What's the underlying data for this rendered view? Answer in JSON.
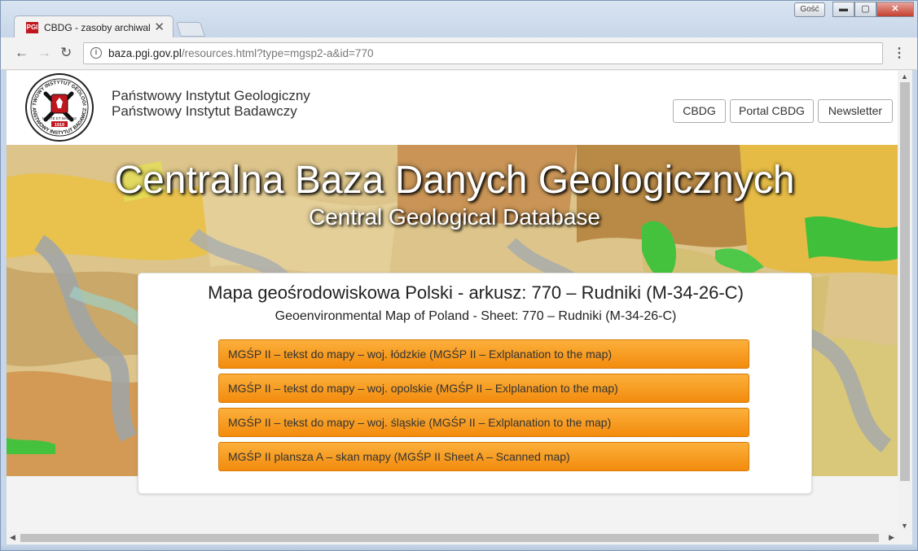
{
  "browser": {
    "tab_title": "CBDG - zasoby archiwaln",
    "favicon_text": "PGI",
    "tab_close": "✕",
    "guest_label": "Gość",
    "url_host": "baza.pgi.gov.pl",
    "url_path": "/resources.html?type=mgsp2-a&id=770",
    "window_min": "▬",
    "window_max": "▢",
    "window_close": "✕"
  },
  "header": {
    "logo_text_top": "PAŃSTWOWY INSTYTUT GEOLOGICZNY",
    "logo_text_bottom": "PAŃSTWOWY INSTYTUT BADAWCZY",
    "logo_motto": "MENTE ET MALLEO",
    "logo_year": "1919",
    "institute_line1": "Państwowy Instytut Geologiczny",
    "institute_line2": "Państwowy Instytut Badawczy",
    "nav_buttons": [
      "CBDG",
      "Portal CBDG",
      "Newsletter"
    ]
  },
  "banner": {
    "title": "Centralna Baza Danych Geologicznych",
    "subtitle": "Central Geological Database"
  },
  "card": {
    "title": "Mapa geośrodowiskowa Polski - arkusz: 770 – Rudniki (M-34-26-C)",
    "subtitle": "Geoenvironmental Map of Poland - Sheet: 770 – Rudniki (M-34-26-C)",
    "resources": [
      "MGŚP II – tekst do mapy – woj. łódzkie (MGŚP II – Exlplanation to the map)",
      "MGŚP II – tekst do mapy – woj. opolskie (MGŚP II – Exlplanation to the map)",
      "MGŚP II – tekst do mapy – woj. śląskie (MGŚP II – Exlplanation to the map)",
      "MGŚP II plansza A – skan mapy (MGŚP II Sheet A – Scanned map)"
    ]
  },
  "colors": {
    "accent_orange": "#f6a021",
    "logo_red": "#c0161d"
  }
}
